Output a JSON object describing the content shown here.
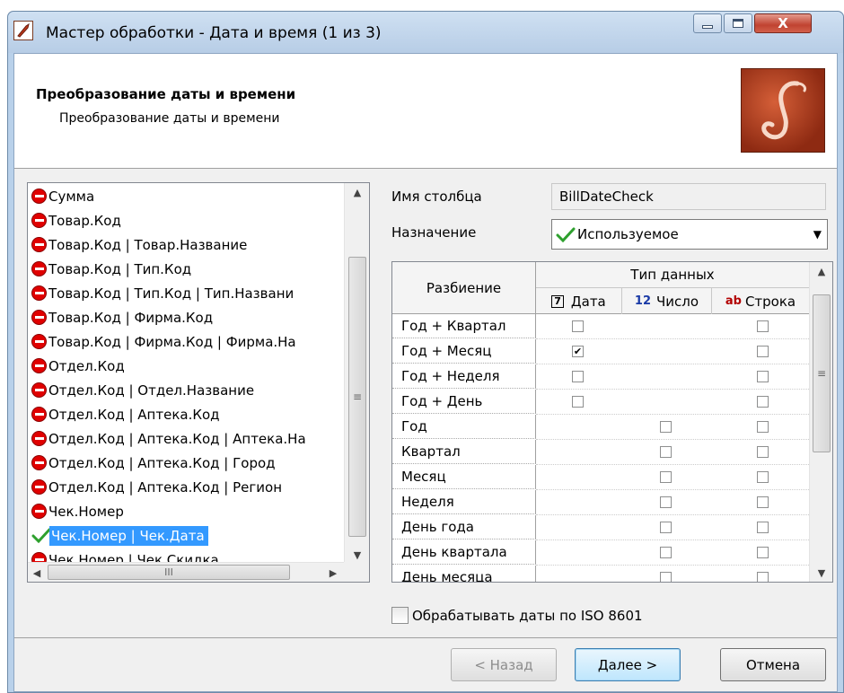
{
  "window": {
    "title": "Мастер обработки - Дата и время (1 из 3)",
    "close_label": "X"
  },
  "header": {
    "title": "Преобразование даты и времени",
    "subtitle": "Преобразование даты и времени"
  },
  "column_list": {
    "items": [
      {
        "label": "Сумма",
        "icon": "stop-icon",
        "selected": false
      },
      {
        "label": "Товар.Код",
        "icon": "stop-icon",
        "selected": false
      },
      {
        "label": "Товар.Код | Товар.Название",
        "icon": "stop-icon",
        "selected": false
      },
      {
        "label": "Товар.Код | Тип.Код",
        "icon": "stop-icon",
        "selected": false
      },
      {
        "label": "Товар.Код | Тип.Код | Тип.Названи",
        "icon": "stop-icon",
        "selected": false
      },
      {
        "label": "Товар.Код | Фирма.Код",
        "icon": "stop-icon",
        "selected": false
      },
      {
        "label": "Товар.Код | Фирма.Код | Фирма.На",
        "icon": "stop-icon",
        "selected": false
      },
      {
        "label": "Отдел.Код",
        "icon": "stop-icon",
        "selected": false
      },
      {
        "label": "Отдел.Код | Отдел.Название",
        "icon": "stop-icon",
        "selected": false
      },
      {
        "label": "Отдел.Код | Аптека.Код",
        "icon": "stop-icon",
        "selected": false
      },
      {
        "label": "Отдел.Код | Аптека.Код | Аптека.На",
        "icon": "stop-icon",
        "selected": false
      },
      {
        "label": "Отдел.Код | Аптека.Код | Город",
        "icon": "stop-icon",
        "selected": false
      },
      {
        "label": "Отдел.Код | Аптека.Код | Регион",
        "icon": "stop-icon",
        "selected": false
      },
      {
        "label": "Чек.Номер",
        "icon": "stop-icon",
        "selected": false
      },
      {
        "label": "Чек.Номер | Чек.Дата",
        "icon": "check-icon",
        "selected": true
      },
      {
        "label": "Чек.Номер | Чек.Скидка",
        "icon": "stop-icon",
        "selected": false
      }
    ],
    "hscroll_grip": "III"
  },
  "form": {
    "column_name_label": "Имя столбца",
    "column_name_value": "BillDateCheck",
    "purpose_label": "Назначение",
    "purpose_value": "Используемое"
  },
  "split_grid": {
    "row_header": "Разбиение",
    "group_header": "Тип данных",
    "columns": [
      {
        "icon_text": "7",
        "label": "Дата"
      },
      {
        "icon_text": "12",
        "label": "Число"
      },
      {
        "icon_text": "ab",
        "label": "Строка"
      }
    ],
    "rows": [
      {
        "label": "Год + Квартал",
        "date": false,
        "number": null,
        "string": false
      },
      {
        "label": "Год + Месяц",
        "date": true,
        "number": null,
        "string": false
      },
      {
        "label": "Год + Неделя",
        "date": false,
        "number": null,
        "string": false
      },
      {
        "label": "Год + День",
        "date": false,
        "number": null,
        "string": false
      },
      {
        "label": "Год",
        "date": null,
        "number": false,
        "string": false
      },
      {
        "label": "Квартал",
        "date": null,
        "number": false,
        "string": false
      },
      {
        "label": "Месяц",
        "date": null,
        "number": false,
        "string": false
      },
      {
        "label": "Неделя",
        "date": null,
        "number": false,
        "string": false
      },
      {
        "label": "День года",
        "date": null,
        "number": false,
        "string": false
      },
      {
        "label": "День квартала",
        "date": null,
        "number": false,
        "string": false
      },
      {
        "label": "День месяца",
        "date": null,
        "number": false,
        "string": false
      }
    ]
  },
  "iso_checkbox": {
    "label": "Обрабатывать даты по ISO 8601",
    "checked": false
  },
  "buttons": {
    "back": "< Назад",
    "next": "Далее >",
    "cancel": "Отмена"
  },
  "colors": {
    "selection": "#3399ff",
    "stop_icon": "#e00000",
    "check_icon": "#2ea02e",
    "logo": "#a8381a"
  }
}
